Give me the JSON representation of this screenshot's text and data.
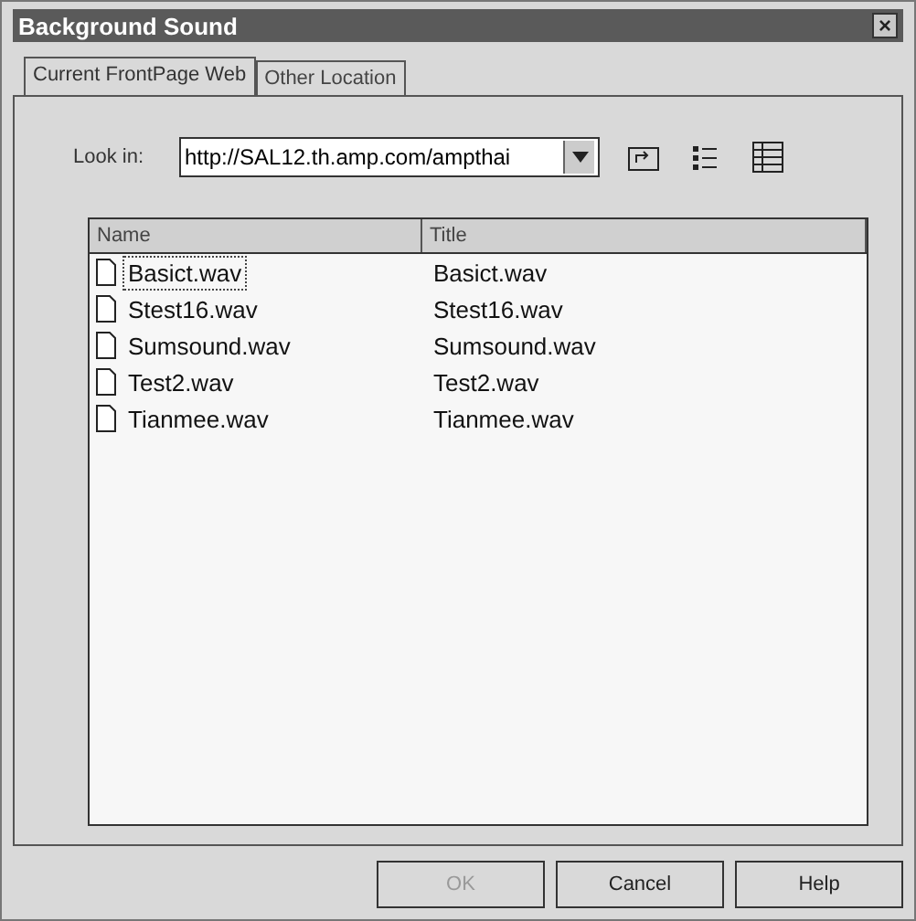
{
  "window": {
    "title": "Background Sound",
    "close": "×"
  },
  "tabs": [
    {
      "label": "Current FrontPage Web",
      "selected": true
    },
    {
      "label": "Other Location",
      "selected": false
    }
  ],
  "look_in": {
    "label": "Look in:",
    "value": "http://SAL12.th.amp.com/ampthai"
  },
  "table": {
    "columns": [
      "Name",
      "Title"
    ],
    "rows": [
      {
        "name": "Basict.wav",
        "title": "Basict.wav",
        "selected": true
      },
      {
        "name": "Stest16.wav",
        "title": "Stest16.wav",
        "selected": false
      },
      {
        "name": "Sumsound.wav",
        "title": "Sumsound.wav",
        "selected": false
      },
      {
        "name": "Test2.wav",
        "title": "Test2.wav",
        "selected": false
      },
      {
        "name": "Tianmee.wav",
        "title": "Tianmee.wav",
        "selected": false
      }
    ]
  },
  "buttons": [
    {
      "label": "OK",
      "disabled": true
    },
    {
      "label": "Cancel",
      "disabled": false
    },
    {
      "label": "Help",
      "disabled": false
    }
  ]
}
